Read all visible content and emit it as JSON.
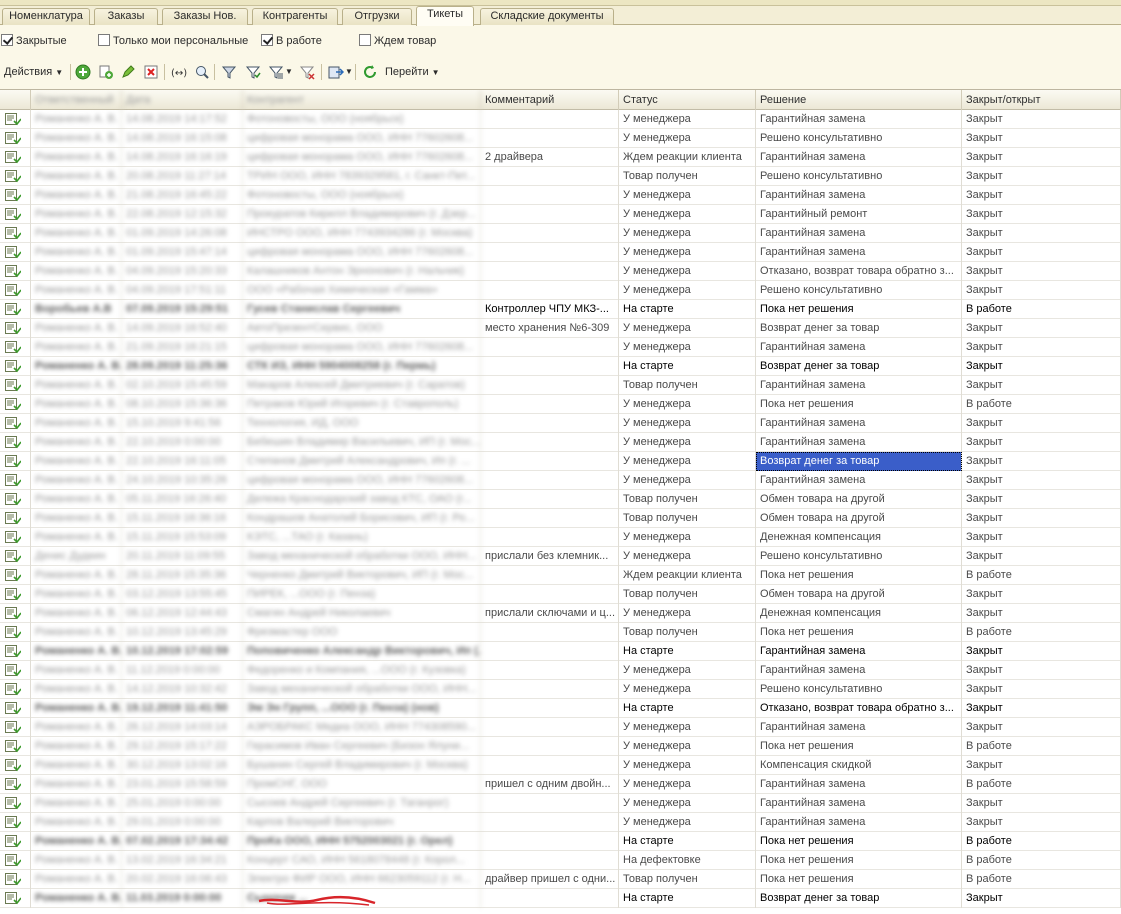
{
  "tabs": [
    {
      "label": "Номенклатура"
    },
    {
      "label": "Заказы"
    },
    {
      "label": "Заказы Нов."
    },
    {
      "label": "Контрагенты"
    },
    {
      "label": "Отгрузки"
    },
    {
      "label": "Тикеты"
    },
    {
      "label": "Складские документы"
    }
  ],
  "active_tab": "Тикеты",
  "filters": {
    "closed": {
      "label": "Закрытые",
      "checked": true
    },
    "personal": {
      "label": "Только мои персональные",
      "checked": false
    },
    "in_work": {
      "label": "В работе",
      "checked": true
    },
    "waiting": {
      "label": "Ждем товар",
      "checked": false
    }
  },
  "toolbar": {
    "actions_label": "Действия",
    "goto_label": "Перейти",
    "icons": [
      "add-icon",
      "copy-add-icon",
      "edit-icon",
      "delete-icon",
      "range-icon",
      "search-icon",
      "filter-icon",
      "filter-set-icon",
      "filter-list-icon",
      "filter-clear-icon",
      "export-icon",
      "refresh-icon"
    ]
  },
  "colors": {
    "background": "#fbf8e8",
    "selection": "#3a5ec9"
  },
  "table": {
    "columns": [
      "Ответственный",
      "Дата",
      "Контрагент",
      "Комментарий",
      "Статус",
      "Решение",
      "Закрыт/открыт"
    ],
    "rows": [
      {
        "resp": "Романенко А. В.",
        "date": "14.08.2019 14:17:52",
        "client": "Фотоновосты, ООО (ноябрьск)",
        "comment": "",
        "status": "У менеджера",
        "decision": "Гарантийная замена",
        "state": "Закрыт",
        "bold": false
      },
      {
        "resp": "Романенко А. В.",
        "date": "14.08.2019 16:15:08",
        "client": "цифровая монорама ООО, ИНН 77602608...",
        "comment": "",
        "status": "У менеджера",
        "decision": "Решено консультативно",
        "state": "Закрыт",
        "bold": false
      },
      {
        "resp": "Романенко А. В.",
        "date": "14.08.2019 16:16:19",
        "client": "цифровая монорама ООО, ИНН 77602608...",
        "comment": "2 драйвера",
        "status": "Ждем реакции клиента",
        "decision": "Гарантийная замена",
        "state": "Закрыт",
        "bold": false
      },
      {
        "resp": "Романенко А. В.",
        "date": "20.08.2019 11:27:14",
        "client": "ТРИН ООО, ИНН 7839329581, г. Санкт-Пет...",
        "comment": "",
        "status": "Товар получен",
        "decision": "Решено консультативно",
        "state": "Закрыт",
        "bold": false
      },
      {
        "resp": "Романенко А. В.",
        "date": "21.08.2019 16:45:22",
        "client": "Фотоновосты, ООО (ноябрьск)",
        "comment": "",
        "status": "У менеджера",
        "decision": "Гарантийная замена",
        "state": "Закрыт",
        "bold": false
      },
      {
        "resp": "Романенко А. В.",
        "date": "22.08.2019 12:15:32",
        "client": "Прокуратов Кирилл Владимирович (г. Дзер...",
        "comment": "",
        "status": "У менеджера",
        "decision": "Гарантийный ремонт",
        "state": "Закрыт",
        "bold": false
      },
      {
        "resp": "Романенко А. В.",
        "date": "01.09.2019 14:26:08",
        "client": "ИНСТРО ООО, ИНН 7743934286 (г. Москва)",
        "comment": "",
        "status": "У менеджера",
        "decision": "Гарантийная замена",
        "state": "Закрыт",
        "bold": false
      },
      {
        "resp": "Романенко А. В.",
        "date": "01.09.2019 15:47:14",
        "client": "цифровая монорама ООО, ИНН 77602608...",
        "comment": "",
        "status": "У менеджера",
        "decision": "Гарантийная замена",
        "state": "Закрыт",
        "bold": false
      },
      {
        "resp": "Романенко А. В.",
        "date": "04.09.2019 15:20:33",
        "client": "Калашников Антон Эрнонович (г. Нальчик)",
        "comment": "",
        "status": "У менеджера",
        "decision": "Отказано, возврат товара обратно з...",
        "state": "Закрыт",
        "bold": false
      },
      {
        "resp": "Романенко А. В.",
        "date": "04.09.2019 17:51:11",
        "client": "ООО «Рабочая Химическая «Гамма»",
        "comment": "",
        "status": "У менеджера",
        "decision": "Решено консультативно",
        "state": "Закрыт",
        "bold": false
      },
      {
        "resp": "Воробьев А.В",
        "date": "07.09.2019 15:29:51",
        "client": "Гусев Станислав Сергеевич",
        "comment": "Контроллер ЧПУ МКЗ-...",
        "status": "На старте",
        "decision": "Пока нет решения",
        "state": "В работе",
        "bold": true
      },
      {
        "resp": "Романенко А. В.",
        "date": "14.09.2019 16:52:40",
        "client": "АвтоПрезентСервис, ООО",
        "comment": "место хранения №6-309",
        "status": "У менеджера",
        "decision": "Возврат денег за товар",
        "state": "Закрыт",
        "bold": false
      },
      {
        "resp": "Романенко А. В.",
        "date": "21.09.2019 16:21:15",
        "client": "цифровая монорама ООО, ИНН 77602608...",
        "comment": "",
        "status": "У менеджера",
        "decision": "Гарантийная замена",
        "state": "Закрыт",
        "bold": false
      },
      {
        "resp": "Романенко А. В.",
        "date": "28.09.2019 11:25:36",
        "client": "СТК ИЗ, ИНН 5904008258 (г. Пермь)",
        "comment": "",
        "status": "На старте",
        "decision": "Возврат денег за товар",
        "state": "Закрыт",
        "bold": true
      },
      {
        "resp": "Романенко А. В.",
        "date": "02.10.2019 15:45:59",
        "client": "Макаров Алексей Дмитриевич (г. Саратов)",
        "comment": "",
        "status": "Товар получен",
        "decision": "Гарантийная замена",
        "state": "Закрыт",
        "bold": false
      },
      {
        "resp": "Романенко А. В.",
        "date": "08.10.2019 15:36:36",
        "client": "Петраков Юрий Игоревич (г. Ставрополь)",
        "comment": "",
        "status": "У менеджера",
        "decision": "Пока нет решения",
        "state": "В работе",
        "bold": false
      },
      {
        "resp": "Романенко А. В.",
        "date": "15.10.2019 9:41:56",
        "client": "Технология, ИД, ООО",
        "comment": "",
        "status": "У менеджера",
        "decision": "Гарантийная замена",
        "state": "Закрыт",
        "bold": false
      },
      {
        "resp": "Романенко А. В.",
        "date": "22.10.2019 0:00:00",
        "client": "Бебешин Владимир Васильевич, ИП (г. Мос...",
        "comment": "",
        "status": "У менеджера",
        "decision": "Гарантийная замена",
        "state": "Закрыт",
        "bold": false
      },
      {
        "resp": "Романенко А. В.",
        "date": "22.10.2019 16:11:05",
        "client": "Степанов Дмитрий Александрович, Ип (г. ...",
        "comment": "",
        "status": "У менеджера",
        "decision": "Возврат денег за товар",
        "state": "Закрыт",
        "bold": false,
        "selected": true
      },
      {
        "resp": "Романенко А. В.",
        "date": "24.10.2019 10:35:26",
        "client": "цифровая монорама ООО, ИНН 77602608...",
        "comment": "",
        "status": "У менеджера",
        "decision": "Гарантийная замена",
        "state": "Закрыт",
        "bold": false
      },
      {
        "resp": "Романенко А. В.",
        "date": "05.11.2019 16:26:40",
        "client": "Дележа Краснодарский завод КТС, ОАО (г...",
        "comment": "",
        "status": "Товар получен",
        "decision": "Обмен товара на другой",
        "state": "Закрыт",
        "bold": false
      },
      {
        "resp": "Романенко А. В.",
        "date": "15.11.2019 16:36:16",
        "client": "Кондрашов Анатолий Борисович, ИП (г. Ро...",
        "comment": "",
        "status": "Товар получен",
        "decision": "Обмен товара на другой",
        "state": "Закрыт",
        "bold": false
      },
      {
        "resp": "Романенко А. В.",
        "date": "15.11.2019 15:53:09",
        "client": "КЭТС, ...ТАО (г. Казань)",
        "comment": "",
        "status": "У менеджера",
        "decision": "Денежная компенсация",
        "state": "Закрыт",
        "bold": false
      },
      {
        "resp": "Денис Дудкин",
        "date": "20.11.2019 11:09:55",
        "client": "Завод механической обработки ООО, ИНН...",
        "comment": "прислали без клемник...",
        "status": "У менеджера",
        "decision": "Решено консультативно",
        "state": "Закрыт",
        "bold": false
      },
      {
        "resp": "Романенко А. В.",
        "date": "28.11.2019 15:35:36",
        "client": "Черненко Дмитрий Викторович, ИП (г. Мос...",
        "comment": "",
        "status": "Ждем реакции клиента",
        "decision": "Пока нет решения",
        "state": "В работе",
        "bold": false
      },
      {
        "resp": "Романенко А. В.",
        "date": "03.12.2019 13:55:45",
        "client": "ПИРЕК, ...ООО (г. Пенза)",
        "comment": "",
        "status": "Товар получен",
        "decision": "Обмен товара на другой",
        "state": "Закрыт",
        "bold": false
      },
      {
        "resp": "Романенко А. В.",
        "date": "06.12.2019 12:44:43",
        "client": "Смагин Андрей Николаевич",
        "comment": "прислали сключами и ц...",
        "status": "У менеджера",
        "decision": "Денежная компенсация",
        "state": "Закрыт",
        "bold": false
      },
      {
        "resp": "Романенко А. В.",
        "date": "10.12.2019 13:45:29",
        "client": "Фрезмастер ООО",
        "comment": "",
        "status": "Товар получен",
        "decision": "Пока нет решения",
        "state": "В работе",
        "bold": false
      },
      {
        "resp": "Романенко А. В.",
        "date": "10.12.2019 17:02:59",
        "client": "Поповиченко Александр Викторович, Ип (...",
        "comment": "",
        "status": "На старте",
        "decision": "Гарантийная замена",
        "state": "Закрыт",
        "bold": true
      },
      {
        "resp": "Романенко А. В.",
        "date": "11.12.2019 0:00:00",
        "client": "Федоренко и Компания, ...ООО (г. Кузовка)",
        "comment": "",
        "status": "У менеджера",
        "decision": "Гарантийная замена",
        "state": "Закрыт",
        "bold": false
      },
      {
        "resp": "Романенко А. В.",
        "date": "14.12.2019 10:32:42",
        "client": "Завод механической обработки ООО, ИНН...",
        "comment": "",
        "status": "У менеджера",
        "decision": "Решено консультативно",
        "state": "Закрыт",
        "bold": false
      },
      {
        "resp": "Романенко А. В.",
        "date": "19.12.2019 11:41:50",
        "client": "Эм Эн Групп, ...ООО (г. Пенза) (нов)",
        "comment": "",
        "status": "На старте",
        "decision": "Отказано, возврат товара обратно з...",
        "state": "Закрыт",
        "bold": true
      },
      {
        "resp": "Романенко А. В.",
        "date": "26.12.2019 14:03:14",
        "client": "АЭРОБРАКС Медиа ООО, ИНН 774308590...",
        "comment": "",
        "status": "У менеджера",
        "decision": "Гарантийная замена",
        "state": "Закрыт",
        "bold": false
      },
      {
        "resp": "Романенко А. В.",
        "date": "29.12.2019 15:17:22",
        "client": "Герасимов Иван Сергеевич (Бизон Ялуни...",
        "comment": "",
        "status": "У менеджера",
        "decision": "Пока нет решения",
        "state": "В работе",
        "bold": false
      },
      {
        "resp": "Романенко А. В.",
        "date": "30.12.2019 13:02:16",
        "client": "Бушанин Сергей Владимирович (г. Москва)",
        "comment": "",
        "status": "У менеджера",
        "decision": "Компенсация скидкой",
        "state": "Закрыт",
        "bold": false
      },
      {
        "resp": "Романенко А. В.",
        "date": "23.01.2019 15:58:59",
        "client": "ПромСНГ, ООО",
        "comment": "пришел с одним двойн...",
        "status": "У менеджера",
        "decision": "Гарантийная замена",
        "state": "В работе",
        "bold": false
      },
      {
        "resp": "Романенко А. В.",
        "date": "25.01.2019 0:00:00",
        "client": "Сысоев Андрей Сергеевич (г. Таганрог)",
        "comment": "",
        "status": "У менеджера",
        "decision": "Гарантийная замена",
        "state": "Закрыт",
        "bold": false
      },
      {
        "resp": "Романенко А. В.",
        "date": "29.01.2019 0:00:00",
        "client": "Карпов Валерий Викторович",
        "comment": "",
        "status": "У менеджера",
        "decision": "Гарантийная замена",
        "state": "Закрыт",
        "bold": false
      },
      {
        "resp": "Романенко А. В.",
        "date": "07.02.2019 17:34:42",
        "client": "ПроКа ООО, ИНН 5752003021 (г. Орел)",
        "comment": "",
        "status": "На старте",
        "decision": "Пока нет решения",
        "state": "В работе",
        "bold": true
      },
      {
        "resp": "Романенко А. В.",
        "date": "13.02.2019 16:34:21",
        "client": "Концерт САО, ИНН 5618078448 (г. Корол...",
        "comment": "",
        "status": "На дефектовке",
        "decision": "Пока нет решения",
        "state": "В работе",
        "bold": false
      },
      {
        "resp": "Романенко А. В.",
        "date": "20.02.2019 16:06:43",
        "client": "Электро ФИР ООО, ИНН 6623059112 (г. Н...",
        "comment": "драйвер пришел с одни...",
        "status": "Товар получен",
        "decision": "Пока нет решения",
        "state": "В работе",
        "bold": false
      },
      {
        "resp": "Романенко А. В.",
        "date": "11.03.2019 0:00:00",
        "client": "Сыночек ...",
        "comment": "",
        "status": "На старте",
        "decision": "Возврат денег за товар",
        "state": "Закрыт",
        "bold": true
      }
    ]
  }
}
